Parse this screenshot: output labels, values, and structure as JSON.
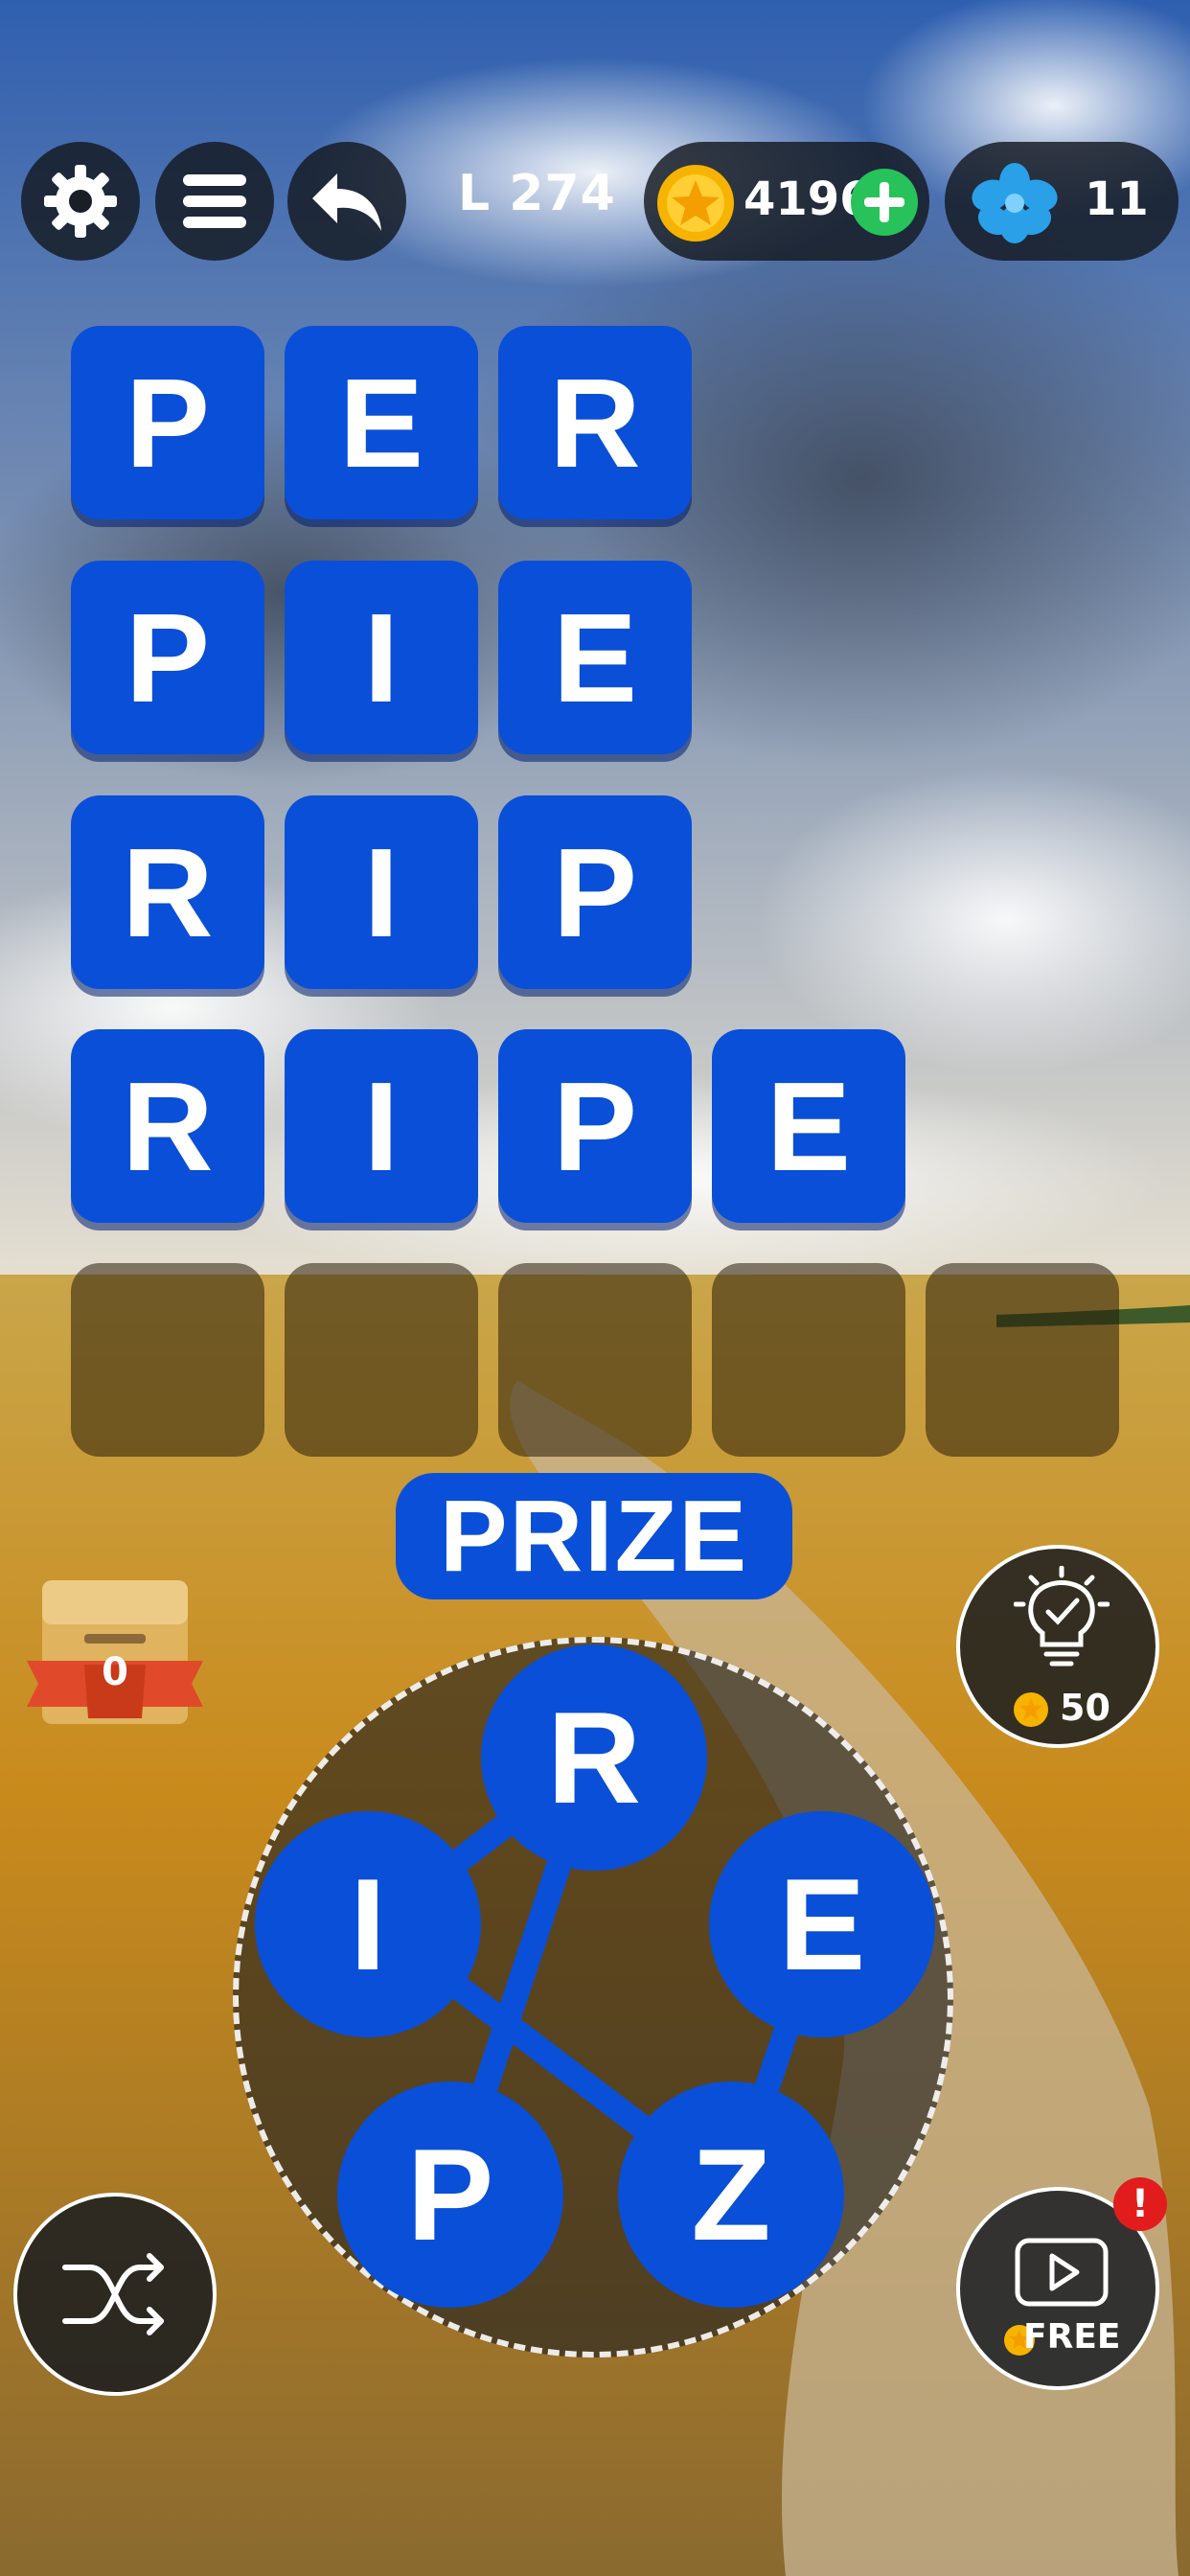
{
  "header": {
    "settings_icon": "gear-icon",
    "menu_icon": "menu-icon",
    "back_icon": "undo-arrow-icon",
    "level": "L 274",
    "coins": "4196",
    "flowers": "11"
  },
  "board": {
    "rows": [
      [
        "P",
        "E",
        "R"
      ],
      [
        "P",
        "I",
        "E"
      ],
      [
        "R",
        "I",
        "P"
      ],
      [
        "R",
        "I",
        "P",
        "E"
      ],
      [
        "",
        "",
        "",
        "",
        ""
      ]
    ]
  },
  "current_word": "PRIZE",
  "wheel": {
    "letters": [
      "R",
      "E",
      "Z",
      "P",
      "I"
    ]
  },
  "chest": {
    "count": "0"
  },
  "hint": {
    "cost": "50"
  },
  "video": {
    "label": "FREE",
    "badge": "!"
  },
  "colors": {
    "tile": "#0a4fd8",
    "empty_tile": "#2a200a",
    "coin": "#f6b400",
    "plus": "#27c25a",
    "flower": "#2aa0e8"
  }
}
